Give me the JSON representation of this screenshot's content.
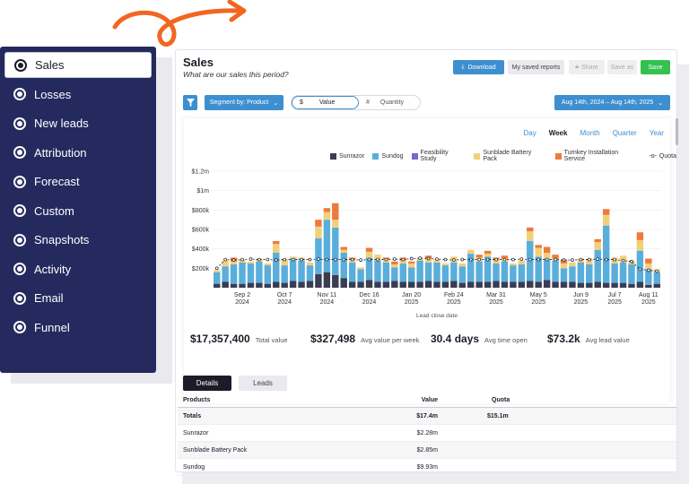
{
  "sidebar": {
    "items": [
      {
        "label": "Sales",
        "icon": "star-icon",
        "active": true
      },
      {
        "label": "Losses",
        "icon": "ban-icon"
      },
      {
        "label": "New leads",
        "icon": "pie-icon"
      },
      {
        "label": "Attribution",
        "icon": "tag-icon"
      },
      {
        "label": "Forecast",
        "icon": "dots-icon"
      },
      {
        "label": "Custom",
        "icon": "target-icon"
      },
      {
        "label": "Snapshots",
        "icon": "bar-chart-icon"
      },
      {
        "label": "Activity",
        "icon": "activity-icon"
      },
      {
        "label": "Email",
        "icon": "email-icon"
      },
      {
        "label": "Funnel",
        "icon": "funnel-icon"
      }
    ]
  },
  "header": {
    "title": "Sales",
    "subtitle": "What are our sales this period?",
    "download_label": "Download",
    "saved_reports_label": "My saved reports",
    "share_label": "Share",
    "save_as_label": "Save as",
    "save_label": "Save"
  },
  "filters": {
    "segment_label": "Segment by: Product",
    "value_symbol": "$",
    "value_label": "Value",
    "quantity_symbol": "#",
    "quantity_label": "Quantity",
    "date_range": "Aug 14th, 2024 – Aug 14th, 2025"
  },
  "period_tabs": [
    "Day",
    "Week",
    "Month",
    "Quarter",
    "Year"
  ],
  "period_selected": "Week",
  "legend": [
    {
      "name": "Sunrazor",
      "color": "#3a3d52"
    },
    {
      "name": "Sundog",
      "color": "#5aaedb"
    },
    {
      "name": "Feasibility Study",
      "color": "#6f6bd0"
    },
    {
      "name": "Sunblade Battery Pack",
      "color": "#f3cf79"
    },
    {
      "name": "Turnkey Installation Service",
      "color": "#ec7a3c"
    },
    {
      "name": "Quota",
      "color": "#1c1c28"
    }
  ],
  "chart_data": {
    "type": "bar",
    "xlabel": "Lead close date",
    "y_ticks": [
      "$200k",
      "$400k",
      "$600k",
      "$800k",
      "$1m",
      "$1.2m"
    ],
    "ylim": [
      0,
      1200000
    ],
    "x_ticks": [
      "Sep 2\n2024",
      "Oct 7\n2024",
      "Nov 11\n2024",
      "Dec 16\n2024",
      "Jan 20\n2025",
      "Feb 24\n2025",
      "Mar 31\n2025",
      "May 5\n2025",
      "Jun 9\n2025",
      "Jul 7\n2025",
      "Aug 11\n2025"
    ],
    "x_tick_positions": [
      3,
      8,
      13,
      18,
      23,
      28,
      33,
      38,
      43,
      47,
      51
    ],
    "quota": [
      200000,
      290000,
      285000,
      290000,
      295000,
      290000,
      290000,
      285000,
      290000,
      290000,
      290000,
      290000,
      295000,
      290000,
      290000,
      290000,
      290000,
      285000,
      290000,
      290000,
      290000,
      295000,
      290000,
      300000,
      305000,
      300000,
      295000,
      290000,
      285000,
      290000,
      290000,
      290000,
      290000,
      290000,
      290000,
      290000,
      295000,
      290000,
      290000,
      290000,
      290000,
      285000,
      285000,
      290000,
      290000,
      295000,
      290000,
      290000,
      280000,
      270000,
      190000,
      180000,
      170000
    ],
    "series": [
      {
        "name": "Sunrazor",
        "values": [
          40000,
          60000,
          40000,
          40000,
          50000,
          50000,
          40000,
          60000,
          50000,
          70000,
          60000,
          70000,
          140000,
          160000,
          130000,
          100000,
          60000,
          60000,
          80000,
          60000,
          60000,
          70000,
          60000,
          60000,
          60000,
          70000,
          60000,
          60000,
          70000,
          50000,
          60000,
          60000,
          60000,
          70000,
          60000,
          60000,
          60000,
          70000,
          60000,
          80000,
          60000,
          60000,
          60000,
          50000,
          50000,
          60000,
          50000,
          50000,
          50000,
          40000,
          60000,
          30000,
          40000
        ]
      },
      {
        "name": "Sundog",
        "values": [
          120000,
          160000,
          200000,
          220000,
          200000,
          220000,
          190000,
          300000,
          180000,
          230000,
          220000,
          160000,
          370000,
          540000,
          490000,
          260000,
          200000,
          130000,
          230000,
          220000,
          200000,
          140000,
          190000,
          150000,
          220000,
          190000,
          200000,
          170000,
          190000,
          170000,
          290000,
          210000,
          260000,
          180000,
          210000,
          170000,
          180000,
          410000,
          260000,
          220000,
          220000,
          140000,
          160000,
          210000,
          190000,
          330000,
          590000,
          200000,
          210000,
          200000,
          320000,
          160000,
          120000
        ]
      },
      {
        "name": "Feasibility Study",
        "values": [
          0,
          0,
          0,
          0,
          0,
          0,
          0,
          0,
          0,
          0,
          0,
          0,
          0,
          0,
          0,
          0,
          0,
          0,
          0,
          0,
          0,
          0,
          0,
          0,
          0,
          0,
          0,
          0,
          0,
          0,
          0,
          0,
          0,
          0,
          0,
          0,
          0,
          0,
          0,
          0,
          0,
          0,
          0,
          0,
          0,
          0,
          0,
          0,
          0,
          0,
          0,
          0,
          0
        ]
      },
      {
        "name": "Sunblade Battery Pack",
        "values": [
          20000,
          60000,
          30000,
          30000,
          20000,
          30000,
          20000,
          90000,
          60000,
          20000,
          30000,
          30000,
          120000,
          80000,
          80000,
          30000,
          30000,
          20000,
          60000,
          60000,
          30000,
          30000,
          30000,
          40000,
          20000,
          40000,
          30000,
          20000,
          60000,
          30000,
          40000,
          40000,
          30000,
          40000,
          30000,
          20000,
          40000,
          100000,
          90000,
          60000,
          20000,
          50000,
          40000,
          40000,
          60000,
          80000,
          110000,
          60000,
          70000,
          40000,
          110000,
          60000,
          30000
        ]
      },
      {
        "name": "Turnkey Installation Service",
        "values": [
          0,
          0,
          40000,
          0,
          0,
          0,
          0,
          30000,
          0,
          0,
          0,
          0,
          70000,
          40000,
          170000,
          30000,
          20000,
          0,
          40000,
          0,
          20000,
          30000,
          30000,
          20000,
          0,
          30000,
          0,
          0,
          0,
          0,
          0,
          30000,
          30000,
          20000,
          30000,
          0,
          0,
          40000,
          30000,
          60000,
          40000,
          40000,
          0,
          0,
          0,
          30000,
          60000,
          0,
          0,
          0,
          80000,
          50000,
          0
        ]
      }
    ]
  },
  "kpis": [
    {
      "value": "$17,357,400",
      "label": "Total value"
    },
    {
      "value": "$327,498",
      "label": "Avg value per week"
    },
    {
      "value": "30.4 days",
      "label": "Avg time open"
    },
    {
      "value": "$73.2k",
      "label": "Avg lead value"
    }
  ],
  "tabs": [
    "Details",
    "Leads"
  ],
  "table": {
    "headers": [
      "Products",
      "Value",
      "Quota"
    ],
    "rows": [
      {
        "product": "Totals",
        "value": "$17.4m",
        "quota": "$15.1m"
      },
      {
        "product": "Sunrazor",
        "value": "$2.28m",
        "quota": ""
      },
      {
        "product": "Sunblade Battery Pack",
        "value": "$2.85m",
        "quota": ""
      },
      {
        "product": "Sundog",
        "value": "$9.93m",
        "quota": ""
      }
    ]
  }
}
